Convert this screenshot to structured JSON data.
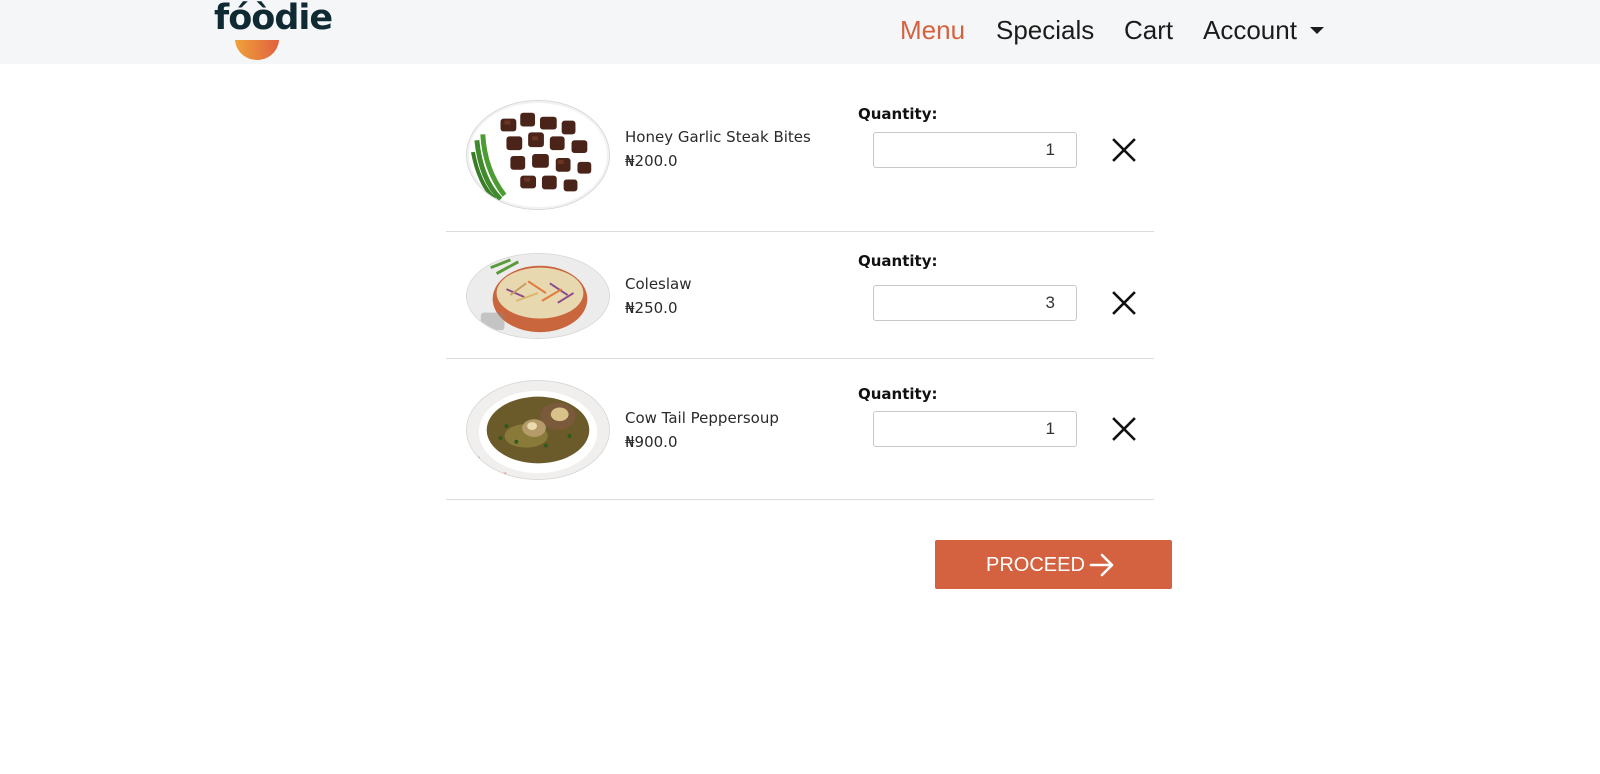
{
  "brand": {
    "name": "fóòdie",
    "colors": {
      "accent": "#d4613f",
      "logo_text": "#0f2a33",
      "nav_bg": "#f5f6f7"
    }
  },
  "nav": {
    "items": [
      {
        "label": "Menu",
        "active": true
      },
      {
        "label": "Specials",
        "active": false
      },
      {
        "label": "Cart",
        "active": false
      },
      {
        "label": "Account",
        "active": false,
        "dropdown": true
      }
    ]
  },
  "cart": {
    "quantity_label": "Quantity:",
    "items": [
      {
        "name": "Honey Garlic Steak Bites",
        "price": "₦200.0",
        "quantity": "1",
        "image": "steak-bites-photo"
      },
      {
        "name": "Coleslaw",
        "price": "₦250.0",
        "quantity": "3",
        "image": "coleslaw-photo"
      },
      {
        "name": "Cow Tail Peppersoup",
        "price": "₦900.0",
        "quantity": "1",
        "image": "peppersoup-photo"
      }
    ],
    "remove_icon": "close-icon"
  },
  "actions": {
    "proceed_label": "PROCEED",
    "proceed_icon": "arrow-right-icon"
  }
}
